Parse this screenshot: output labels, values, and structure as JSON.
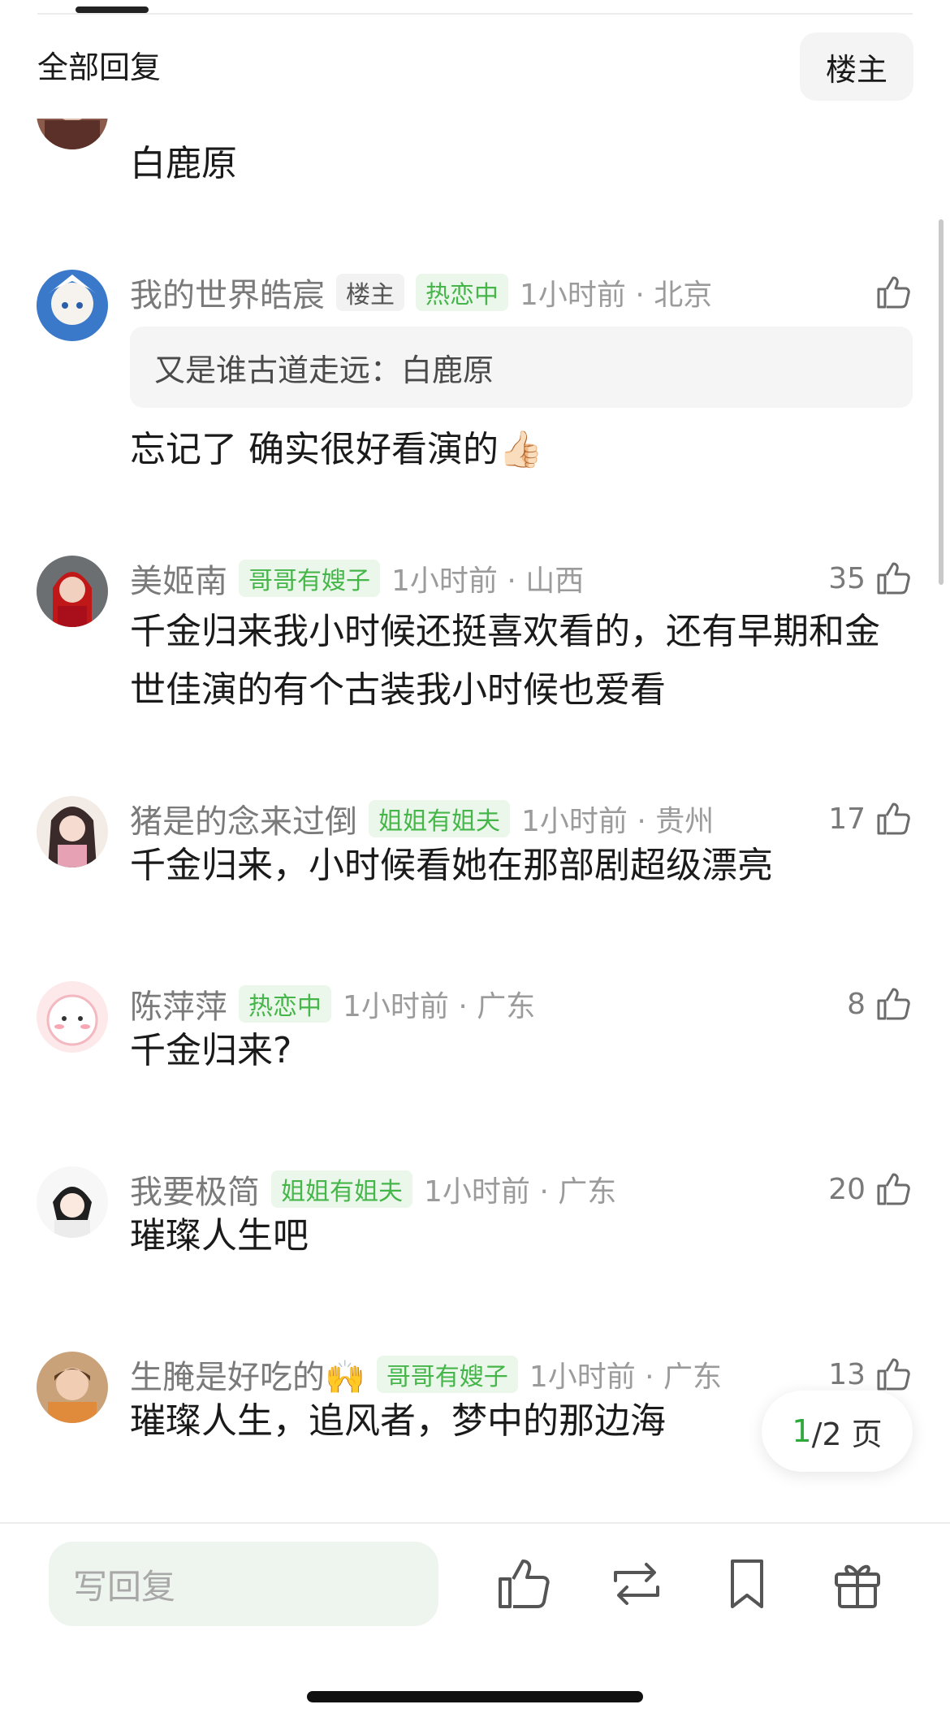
{
  "header": {
    "title": "全部回复",
    "owner_filter": "楼主"
  },
  "comments": [
    {
      "content": "白鹿原"
    },
    {
      "username": "我的世界皓宸",
      "badges": [
        "楼主",
        "热恋中"
      ],
      "time": "1小时前 · 北京",
      "likes": "",
      "quote": "又是谁古道走远：白鹿原",
      "content": "忘记了 确实很好看演的👍🏻"
    },
    {
      "username": "美姬南",
      "badges": [
        "哥哥有嫂子"
      ],
      "time": "1小时前 · 山西",
      "likes": "35",
      "content": "千金归来我小时候还挺喜欢看的，还有早期和金世佳演的有个古装我小时候也爱看"
    },
    {
      "username": "猪是的念来过倒",
      "badges": [
        "姐姐有姐夫"
      ],
      "time": "1小时前 · 贵州",
      "likes": "17",
      "content": "千金归来，小时候看她在那部剧超级漂亮"
    },
    {
      "username": "陈萍萍",
      "badges": [
        "热恋中"
      ],
      "time": "1小时前 · 广东",
      "likes": "8",
      "content": "千金归来?"
    },
    {
      "username": "我要极简",
      "badges": [
        "姐姐有姐夫"
      ],
      "time": "1小时前 · 广东",
      "likes": "20",
      "content": "璀璨人生吧"
    },
    {
      "username": "生腌是好吃的🙌",
      "badges": [
        "哥哥有嫂子"
      ],
      "time": "1小时前 · 广东",
      "likes": "13",
      "content": "璀璨人生，追风者，梦中的那边海"
    }
  ],
  "pagination": {
    "current": "1",
    "total_text": "/2 页"
  },
  "bottom_bar": {
    "reply_placeholder": "写回复"
  },
  "colors": {
    "accent_green": "#46b64a",
    "badge_green_bg": "#eaf7ea",
    "meta_gray": "#9b9b9b"
  },
  "icons": [
    "thumbs-up-icon",
    "repost-icon",
    "bookmark-icon",
    "gift-icon"
  ]
}
